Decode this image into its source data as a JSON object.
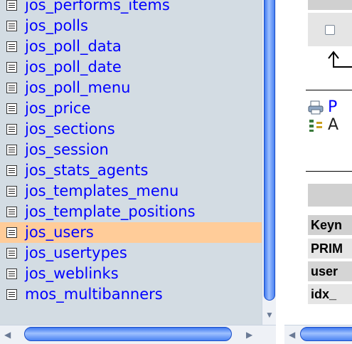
{
  "table_list": [
    {
      "name": "jos_performs_items",
      "selected": false
    },
    {
      "name": "jos_polls",
      "selected": false
    },
    {
      "name": "jos_poll_data",
      "selected": false
    },
    {
      "name": "jos_poll_date",
      "selected": false
    },
    {
      "name": "jos_poll_menu",
      "selected": false
    },
    {
      "name": "jos_price",
      "selected": false
    },
    {
      "name": "jos_sections",
      "selected": false
    },
    {
      "name": "jos_session",
      "selected": false
    },
    {
      "name": "jos_stats_agents",
      "selected": false
    },
    {
      "name": "jos_templates_menu",
      "selected": false
    },
    {
      "name": "jos_template_positions",
      "selected": false
    },
    {
      "name": "jos_users",
      "selected": true
    },
    {
      "name": "jos_usertypes",
      "selected": false
    },
    {
      "name": "jos_weblinks",
      "selected": false
    },
    {
      "name": "mos_multibanners",
      "selected": false
    }
  ],
  "right_panel": {
    "action_export_label": "P",
    "action_add_label": "A",
    "index_rows": [
      "Keyn",
      "PRIM",
      "user",
      "idx_"
    ]
  },
  "colors": {
    "sidebar_bg": "#d3dce3",
    "selected_row_bg": "#ffcc99",
    "link_color": "#0000ff",
    "scrollbar_blue": "#3f79f0"
  }
}
